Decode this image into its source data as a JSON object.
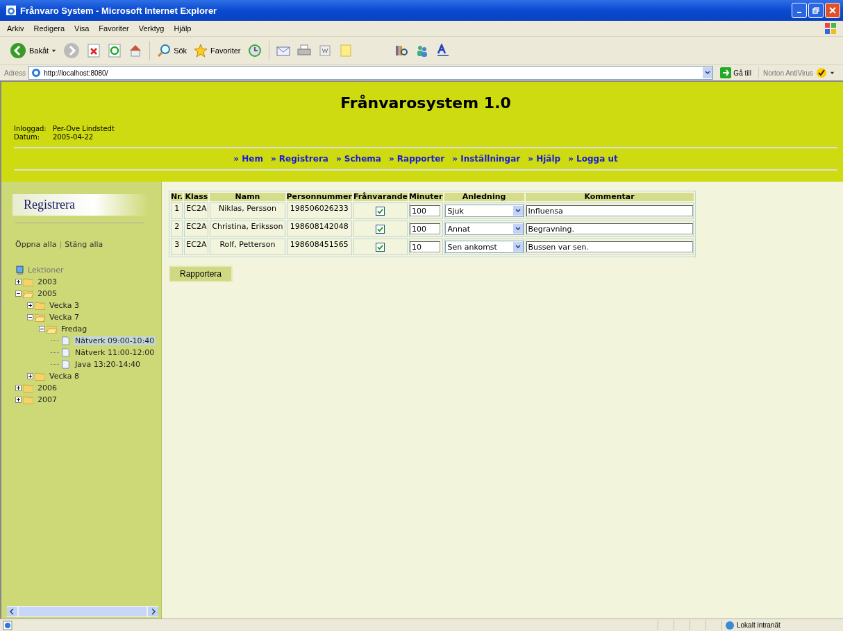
{
  "window": {
    "title": "Frånvaro System - Microsoft Internet Explorer"
  },
  "menu": [
    "Arkiv",
    "Redigera",
    "Visa",
    "Favoriter",
    "Verktyg",
    "Hjälp"
  ],
  "toolbar": {
    "back": "Bakåt",
    "search": "Sök",
    "favorites": "Favoriter"
  },
  "address": {
    "label": "Adress",
    "value": "http://localhost:8080/",
    "go": "Gå till",
    "addon": "Norton AntiVirus"
  },
  "header": {
    "title": "Frånvarosystem 1.0",
    "user_label": "Inloggad:",
    "user": "Per-Ove Lindstedt",
    "date_label": "Datum:",
    "date": "2005-04-22"
  },
  "nav": [
    {
      "label": "» Hem"
    },
    {
      "label": "» Registrera"
    },
    {
      "label": "» Schema"
    },
    {
      "label": "» Rapporter"
    },
    {
      "label": "» Inställningar"
    },
    {
      "label": "» Hjälp"
    },
    {
      "label": "» Logga ut"
    }
  ],
  "sidebar": {
    "title": "Registrera",
    "open_all": "Öppna alla",
    "separator": "|",
    "close_all": "Stäng alla",
    "root": "Lektioner",
    "tree": [
      {
        "label": "2003",
        "kind": "folder",
        "expanded": false
      },
      {
        "label": "2005",
        "kind": "folder",
        "expanded": true,
        "children": [
          {
            "label": "Vecka 3",
            "kind": "folder",
            "expanded": false
          },
          {
            "label": "Vecka 7",
            "kind": "folder",
            "expanded": true,
            "children": [
              {
                "label": "Fredag",
                "kind": "folder",
                "expanded": true,
                "children": [
                  {
                    "label": "Nätverk 09:00-10:40",
                    "kind": "lesson",
                    "selected": true
                  },
                  {
                    "label": "Nätverk 11:00-12:00",
                    "kind": "lesson",
                    "selected": false
                  },
                  {
                    "label": "Java 13:20-14:40",
                    "kind": "lesson",
                    "selected": false
                  }
                ]
              }
            ]
          },
          {
            "label": "Vecka 8",
            "kind": "folder",
            "expanded": false
          }
        ]
      },
      {
        "label": "2006",
        "kind": "folder",
        "expanded": false
      },
      {
        "label": "2007",
        "kind": "folder",
        "expanded": false
      }
    ]
  },
  "table": {
    "columns": [
      "Nr.",
      "Klass",
      "Namn",
      "Personnummer",
      "Frånvarande",
      "Minuter",
      "Anledning",
      "Kommentar"
    ],
    "rows": [
      {
        "nr": "1",
        "klass": "EC2A",
        "namn": "Niklas, Persson",
        "personnummer": "198506026233",
        "absent": true,
        "minutes": "100",
        "reason": "Sjuk",
        "comment": "Influensa"
      },
      {
        "nr": "2",
        "klass": "EC2A",
        "namn": "Christina, Eriksson",
        "personnummer": "198608142048",
        "absent": true,
        "minutes": "100",
        "reason": "Annat",
        "comment": "Begravning."
      },
      {
        "nr": "3",
        "klass": "EC2A",
        "namn": "Rolf, Petterson",
        "personnummer": "198608451565",
        "absent": true,
        "minutes": "10",
        "reason": "Sen ankomst",
        "comment": "Bussen var sen."
      }
    ]
  },
  "submit": "Rapportera",
  "status_bar": {
    "zone": "Lokalt intranät"
  }
}
